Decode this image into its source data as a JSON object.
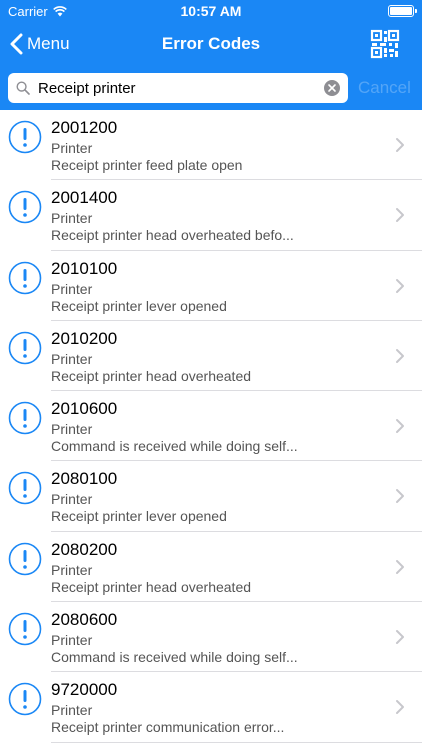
{
  "status_bar": {
    "carrier": "Carrier",
    "time": "10:57 AM",
    "battery_level": 1.0
  },
  "nav": {
    "back_label": "Menu",
    "title": "Error Codes"
  },
  "search": {
    "value": "Receipt printer",
    "cancel_label": "Cancel"
  },
  "colors": {
    "accent": "#1a87f5",
    "icon": "#1a87f5",
    "secondary_text": "#555555"
  },
  "items": [
    {
      "code": "2001200",
      "category": "Printer",
      "description": "Receipt printer feed plate open"
    },
    {
      "code": "2001400",
      "category": "Printer",
      "description": "Receipt printer head overheated befo..."
    },
    {
      "code": "2010100",
      "category": "Printer",
      "description": "Receipt printer lever opened"
    },
    {
      "code": "2010200",
      "category": "Printer",
      "description": "Receipt printer head overheated"
    },
    {
      "code": "2010600",
      "category": "Printer",
      "description": "Command is received while doing self..."
    },
    {
      "code": "2080100",
      "category": "Printer",
      "description": "Receipt printer lever opened"
    },
    {
      "code": "2080200",
      "category": "Printer",
      "description": "Receipt printer head overheated"
    },
    {
      "code": "2080600",
      "category": "Printer",
      "description": "Command is received while doing self..."
    },
    {
      "code": "9720000",
      "category": "Printer",
      "description": "Receipt printer communication error..."
    }
  ]
}
